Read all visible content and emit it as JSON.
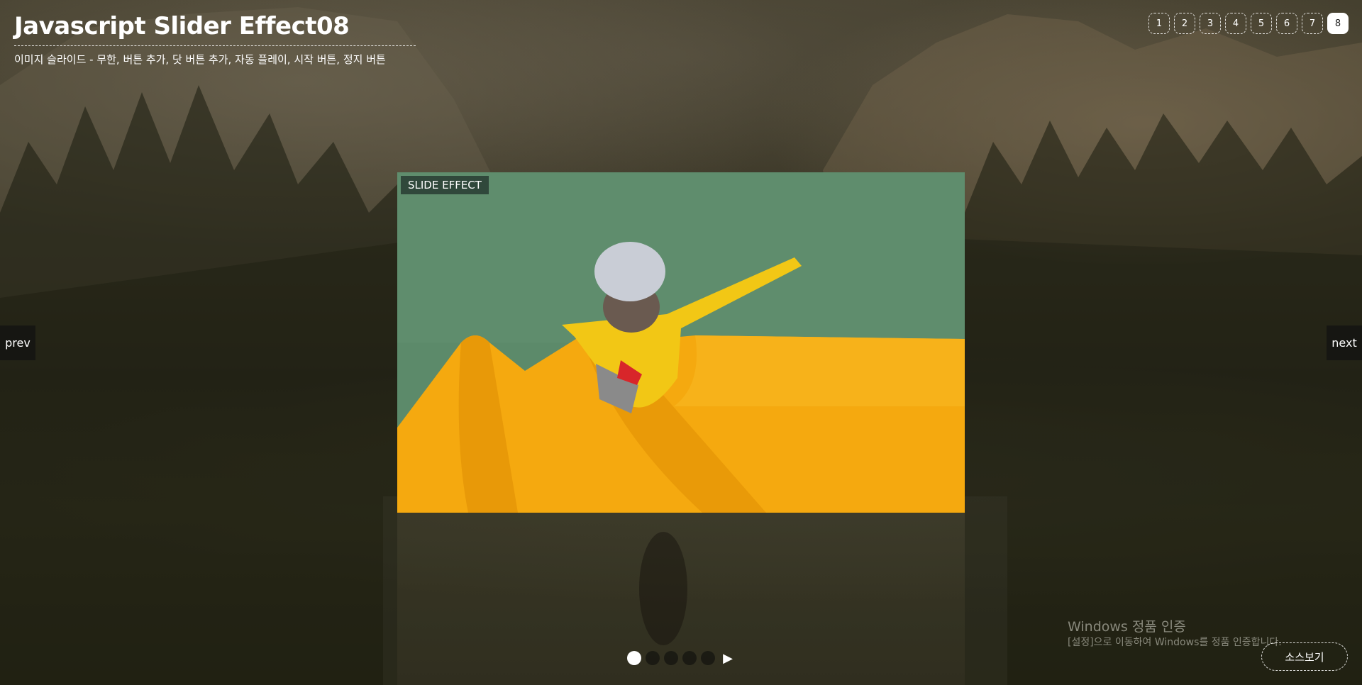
{
  "header": {
    "title": "Javascript Slider Effect08",
    "subtitle": "이미지 슬라이드 - 무한, 버튼 추가, 닷 버튼 추가, 자동 플레이, 시작 버튼, 정지 버튼"
  },
  "effect_nav": {
    "items": [
      "1",
      "2",
      "3",
      "4",
      "5",
      "6",
      "7",
      "8"
    ],
    "active": "8"
  },
  "slider": {
    "tag": "SLIDE EFFECT",
    "prev_label": "prev",
    "next_label": "next",
    "dot_count": 5,
    "active_dot": 1,
    "play_icon": "▶"
  },
  "watermark": {
    "title": "Windows 정품 인증",
    "desc": "[설정]으로 이동하여 Windows를 정품 인증합니다."
  },
  "source_button": "소스보기",
  "colors": {
    "accent": "#ffffff",
    "slide_bg": "#5c8a6a",
    "slide_yellow": "#f5a90f"
  }
}
